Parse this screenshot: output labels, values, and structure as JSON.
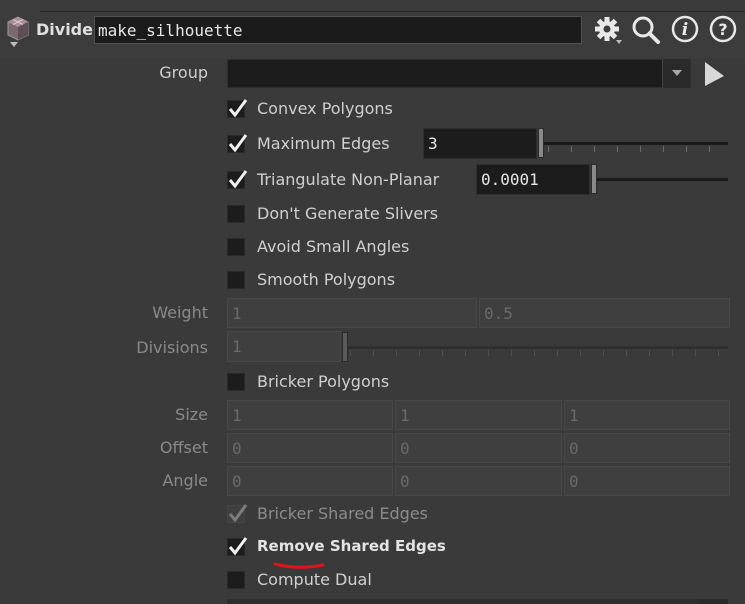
{
  "header": {
    "node_type": "Divide",
    "node_name": "make_silhouette",
    "icons": [
      "gear-icon",
      "search-icon",
      "info-icon",
      "help-icon"
    ]
  },
  "group": {
    "label": "Group",
    "value": ""
  },
  "convex_polygons": {
    "label": "Convex Polygons",
    "checked": true
  },
  "maximum_edges": {
    "label": "Maximum Edges",
    "checked": true,
    "value": "3"
  },
  "triangulate": {
    "label": "Triangulate Non-Planar",
    "checked": true,
    "value": "0.0001"
  },
  "dont_generate_slivers": {
    "label": "Don't Generate Slivers",
    "checked": false
  },
  "avoid_small_angles": {
    "label": "Avoid Small Angles",
    "checked": false
  },
  "smooth_polygons": {
    "label": "Smooth Polygons",
    "checked": false
  },
  "weight": {
    "label": "Weight",
    "values": [
      "1",
      "0.5"
    ]
  },
  "divisions": {
    "label": "Divisions",
    "value": "1"
  },
  "bricker_polygons": {
    "label": "Bricker Polygons",
    "checked": false
  },
  "size": {
    "label": "Size",
    "values": [
      "1",
      "1",
      "1"
    ]
  },
  "offset": {
    "label": "Offset",
    "values": [
      "0",
      "0",
      "0"
    ]
  },
  "angle": {
    "label": "Angle",
    "values": [
      "0",
      "0",
      "0"
    ]
  },
  "bricker_shared_edges": {
    "label": "Bricker Shared Edges",
    "checked": true
  },
  "remove_shared_edges": {
    "label": "Remove Shared Edges",
    "checked": true
  },
  "compute_dual": {
    "label": "Compute Dual",
    "checked": false
  },
  "colors": {
    "accent_underline": "#e0141a"
  }
}
